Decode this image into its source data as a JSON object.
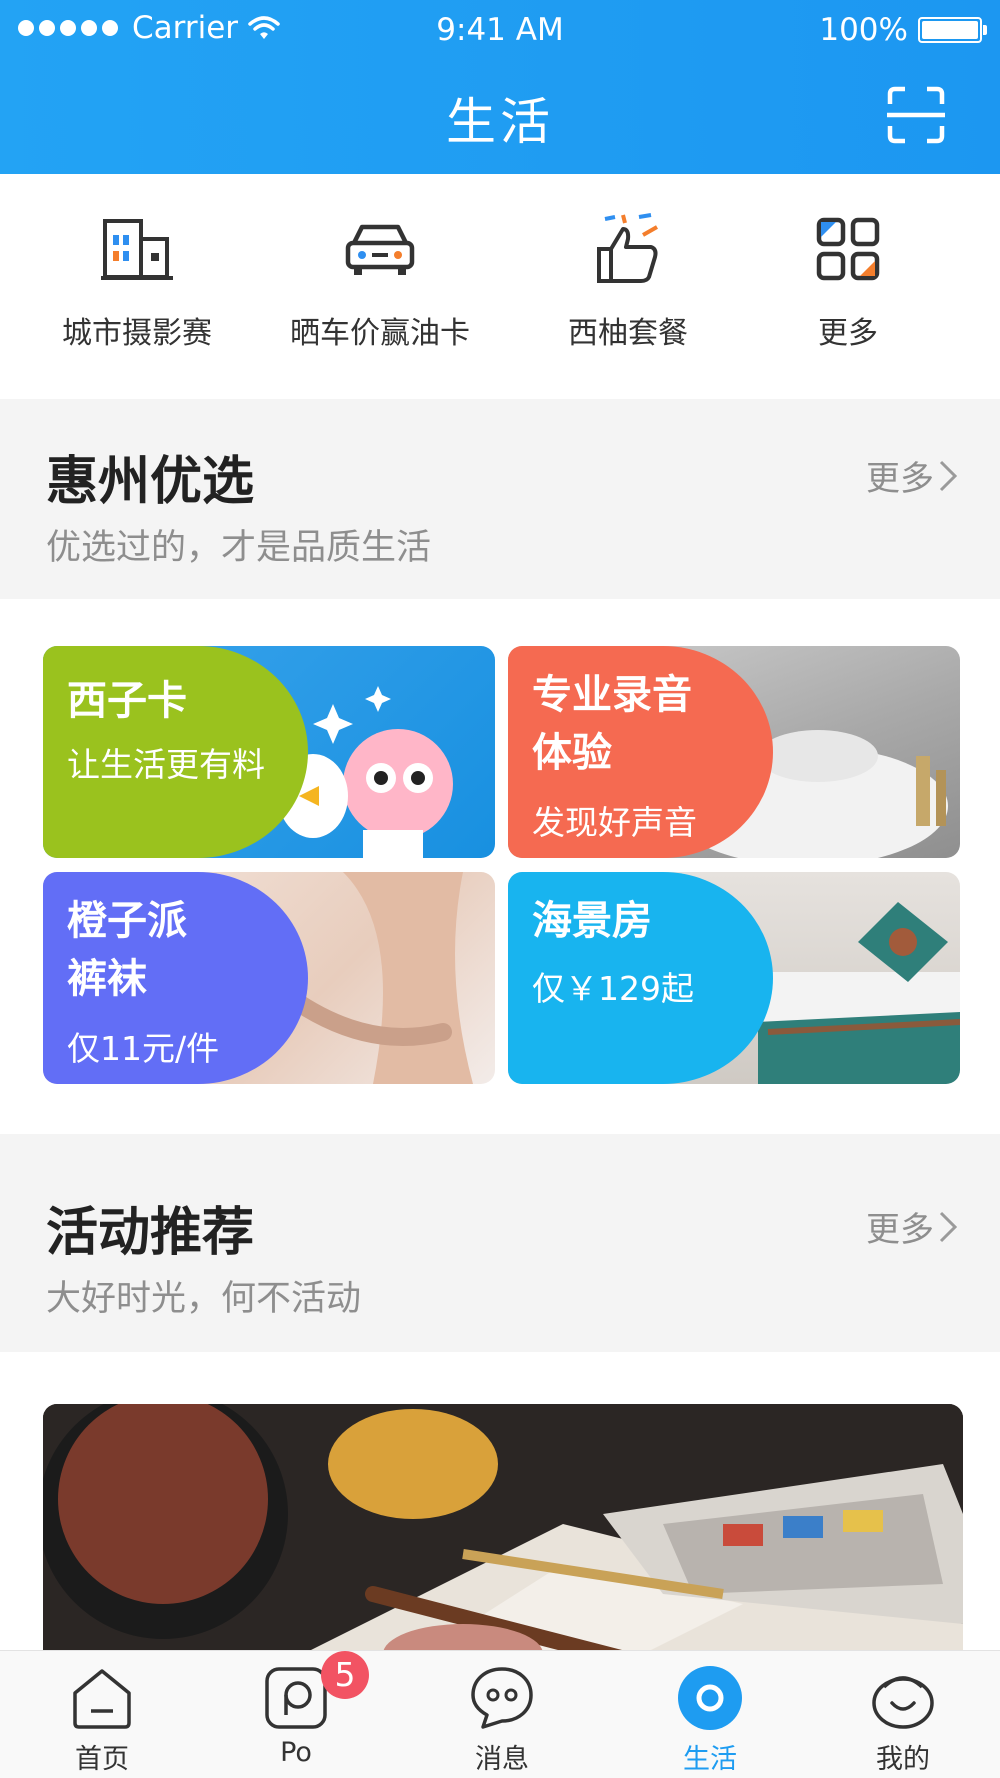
{
  "status_bar": {
    "carrier": "Carrier",
    "time": "9:41 AM",
    "battery": "100%"
  },
  "header": {
    "title": "生活"
  },
  "quick_menu": [
    {
      "label": "城市摄影赛",
      "icon": "city-building-icon"
    },
    {
      "label": "晒车价赢油卡",
      "icon": "car-icon"
    },
    {
      "label": "西柚套餐",
      "icon": "thumbs-up-icon"
    },
    {
      "label": "更多",
      "icon": "grid-more-icon"
    }
  ],
  "section_featured": {
    "title": "惠州优选",
    "subtitle": "优选过的，才是品质生活",
    "more": "更多"
  },
  "cards": [
    {
      "title": "西子卡",
      "subtitle": "让生活更有料",
      "color": "#9ac21e"
    },
    {
      "title": "专业录音",
      "title2": "体验",
      "subtitle": "发现好声音",
      "color": "#f56a51"
    },
    {
      "title": "橙子派",
      "title2": "裤袜",
      "subtitle": "仅11元/件",
      "color": "#626ef6"
    },
    {
      "title": "海景房",
      "subtitle": "仅￥129起",
      "color": "#18b4ef"
    }
  ],
  "section_activity": {
    "title": "活动推荐",
    "subtitle": "大好时光，何不活动",
    "more": "更多"
  },
  "tab_bar": [
    {
      "label": "首页",
      "icon": "home-icon"
    },
    {
      "label": "Po",
      "icon": "po-icon",
      "badge": "5"
    },
    {
      "label": "消息",
      "icon": "message-icon"
    },
    {
      "label": "生活",
      "icon": "life-icon",
      "active": true
    },
    {
      "label": "我的",
      "icon": "profile-icon"
    }
  ],
  "colors": {
    "header": "#1e9cf1",
    "accent": "#1e9cf1",
    "badge": "#f25363"
  }
}
